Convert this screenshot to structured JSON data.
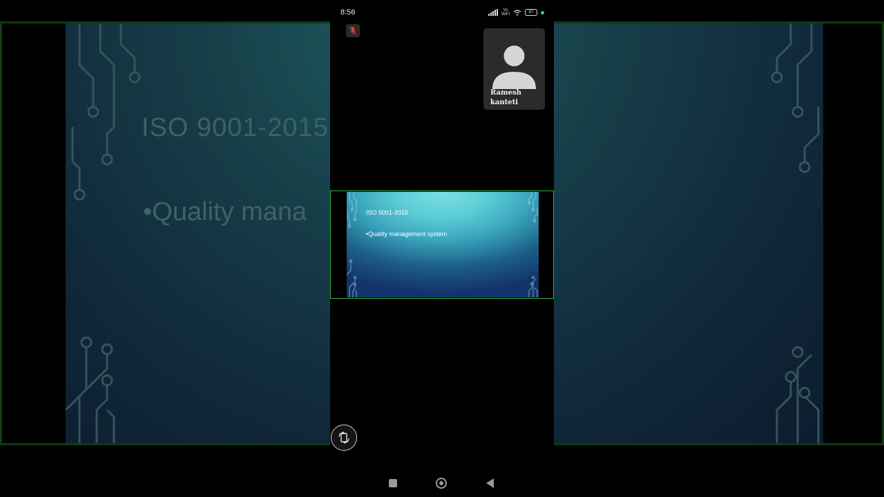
{
  "status_bar": {
    "time": "8:56",
    "network_label_top": "Vo",
    "network_label_bottom": "WiFi",
    "battery": "87"
  },
  "meeting": {
    "mic_state": "muted",
    "participant": {
      "name_line1": "Ramesh",
      "name_line2": "kanteti"
    }
  },
  "shared_slide": {
    "title": "ISO 9001-2015",
    "bullet": "•Quality management system"
  },
  "background_slide": {
    "title": "ISO 9001-2015",
    "bullet": "•Quality mana"
  },
  "colors": {
    "share_border": "#32b23a",
    "status_dot": "#3fd15a",
    "mic_off": "#e0453a"
  },
  "icons": {
    "mic": "mic-off-icon",
    "rotate": "rotate-screen-icon",
    "recents": "recents-icon",
    "home": "home-icon",
    "back": "back-icon"
  }
}
